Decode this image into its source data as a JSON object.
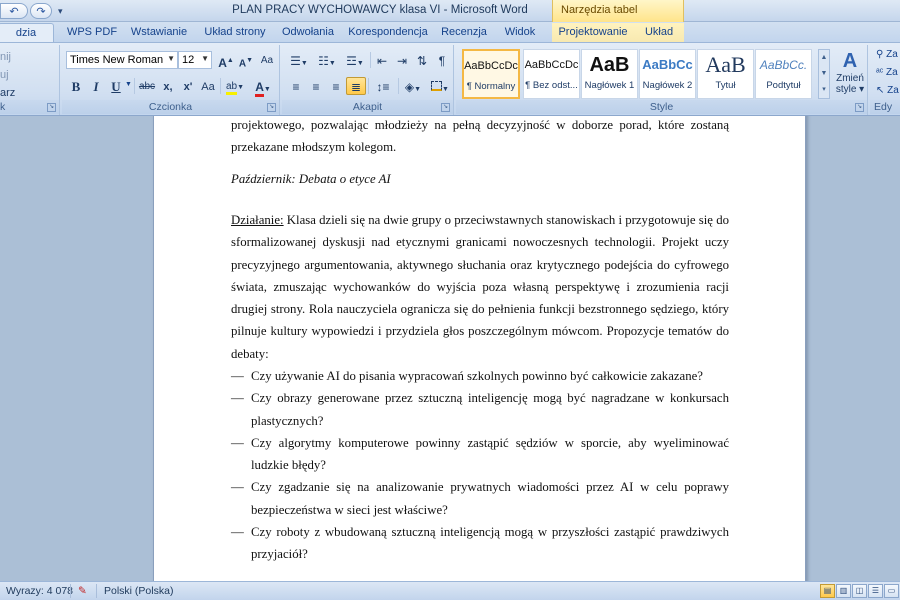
{
  "window": {
    "title": "PLAN PRACY WYCHOWAWCY klasa VI - Microsoft Word",
    "context_tab_group": "Narzędzia tabel"
  },
  "tabs": [
    "dzia główne",
    "WPS PDF",
    "Wstawianie",
    "Układ strony",
    "Odwołania",
    "Korespondencja",
    "Recenzja",
    "Widok",
    "Projektowanie",
    "Układ"
  ],
  "ribbon": {
    "clipboard": {
      "items": [
        "nij",
        "uj",
        "arz formatów"
      ],
      "label": "k"
    },
    "font": {
      "label": "Czcionka",
      "font_name": "Times New Roman",
      "font_size": "12",
      "grow": "A",
      "shrink": "A",
      "clear": "Aa",
      "bold": "B",
      "italic": "I",
      "underline": "U",
      "strike": "abc",
      "subscript": "x,",
      "superscript": "x'",
      "change_case": "Aa",
      "highlight": "ab",
      "font_color": "A"
    },
    "paragraph": {
      "label": "Akapit"
    },
    "styles": {
      "label": "Style",
      "items": [
        {
          "sample": "AaBbCcDc",
          "name": "¶ Normalny"
        },
        {
          "sample": "AaBbCcDc",
          "name": "¶ Bez odst..."
        },
        {
          "sample": "AaB",
          "name": "Nagłówek 1"
        },
        {
          "sample": "AaBbCc",
          "name": "Nagłówek 2"
        },
        {
          "sample": "AaB",
          "name": "Tytuł"
        },
        {
          "sample": "AaBbCc.",
          "name": "Podtytuł"
        }
      ],
      "change_styles": "Zmień style",
      "change_styles_line1": "Zmień",
      "change_styles_line2": "style"
    },
    "editing": {
      "label": "Edy",
      "items": [
        "Za",
        "Za",
        "Za"
      ]
    }
  },
  "document": {
    "paragraph1": "projektowego, pozwalając młodzieży na pełną decyzyjność w doborze porad, które zostaną przekazane młodszym kolegom.",
    "heading": "Październik: Debata o etyce AI",
    "action_label": "Działanie:",
    "paragraph2": " Klasa dzieli się na dwie grupy o przeciwstawnych stanowiskach i przygotowuje się do sformalizowanej dyskusji nad etycznymi granicami nowoczesnych technologii. Projekt uczy precyzyjnego argumentowania, aktywnego słuchania oraz krytycznego podejścia do cyfrowego świata, zmuszając wychowanków do wyjścia poza własną perspektywę i zrozumienia racji drugiej strony. Rola nauczyciela ogranicza się do pełnienia funkcji bezstronnego sędziego, który pilnuje kultury wypowiedzi i przydziela głos poszczególnym mówcom. Propozycje tematów do debaty:",
    "bullet_dash": "—",
    "bullets": [
      "Czy używanie AI do pisania wypracowań szkolnych powinno być całkowicie zakazane?",
      "Czy obrazy generowane przez sztuczną inteligencję mogą być nagradzane w konkursach plastycznych?",
      "Czy algorytmy komputerowe powinny zastąpić sędziów w sporcie, aby wyeliminować ludzkie błędy?",
      "Czy zgadzanie się na analizowanie prywatnych wiadomości przez AI w celu poprawy bezpieczeństwa w sieci jest właściwe?",
      "Czy roboty z wbudowaną sztuczną inteligencją mogą w przyszłości zastąpić prawdziwych przyjaciół?"
    ]
  },
  "statusbar": {
    "words": "Wyrazy: 4 078",
    "language": "Polski (Polska)"
  }
}
